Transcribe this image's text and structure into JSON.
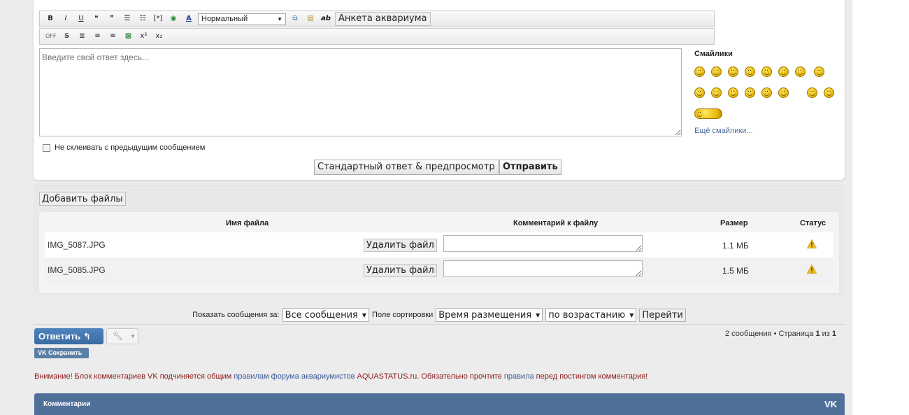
{
  "editor": {
    "toolbar_row1": {
      "bold": "B",
      "italic": "I",
      "underline": "U",
      "font_size_label": "Нормальный",
      "ab_label": "ab",
      "anketa_button": "Анкета аквариума"
    },
    "toolbar_row2": {
      "off_label": "OFF",
      "superscript": "x²",
      "subscript": "x₂"
    },
    "textarea_placeholder": "Введите свой ответ здесь...",
    "no_merge_checkbox_label": "Не склеивать с предыдущим сообщением",
    "preview_button": "Стандартный ответ & предпросмотр",
    "send_button": "Отправить"
  },
  "smilies": {
    "title": "Смайлики",
    "count": 17,
    "more_link": "Ещё смайлики..."
  },
  "attachments": {
    "add_button": "Добавить файлы",
    "columns": {
      "name": "Имя файла",
      "comment": "Комментарий к файлу",
      "size": "Размер",
      "status": "Статус"
    },
    "files": [
      {
        "name": "IMG_5087.JPG",
        "delete_label": "Удалить файл",
        "size": "1.1 МБ",
        "status_icon": "warning-icon"
      },
      {
        "name": "IMG_5085.JPG",
        "delete_label": "Удалить файл",
        "size": "1.5 МБ",
        "status_icon": "warning-icon"
      }
    ]
  },
  "sort_bar": {
    "show_label": "Показать сообщения за:",
    "show_value": "Все сообщения",
    "sort_label": "Поле сортировки",
    "sort_value": "Время размещения",
    "order_value": "по возрастанию",
    "go_button": "Перейти"
  },
  "actions": {
    "reply_button": "Ответить",
    "vk_save_button": "Сохранить",
    "vk_badge": "VK"
  },
  "pagination": {
    "count_text": "2 сообщения • Страница",
    "current": "1",
    "of": "из",
    "total": "1"
  },
  "notice": {
    "part1": "Внимание! Блок комментариев VK подчиняется общим",
    "link1": "правилам форума аквариумистов",
    "part2": "AQUASTATUS.ru. Обязательно прочтите",
    "link2": "правила",
    "part3": "перед постингом комментария!"
  },
  "comments_section": {
    "title": "Комментарии",
    "logo": "VK"
  },
  "colors": {
    "accent_blue": "#4a7ab5",
    "vk_blue": "#50709a",
    "notice_red": "#8b1a1a",
    "warning_yellow": "#f0c020"
  }
}
